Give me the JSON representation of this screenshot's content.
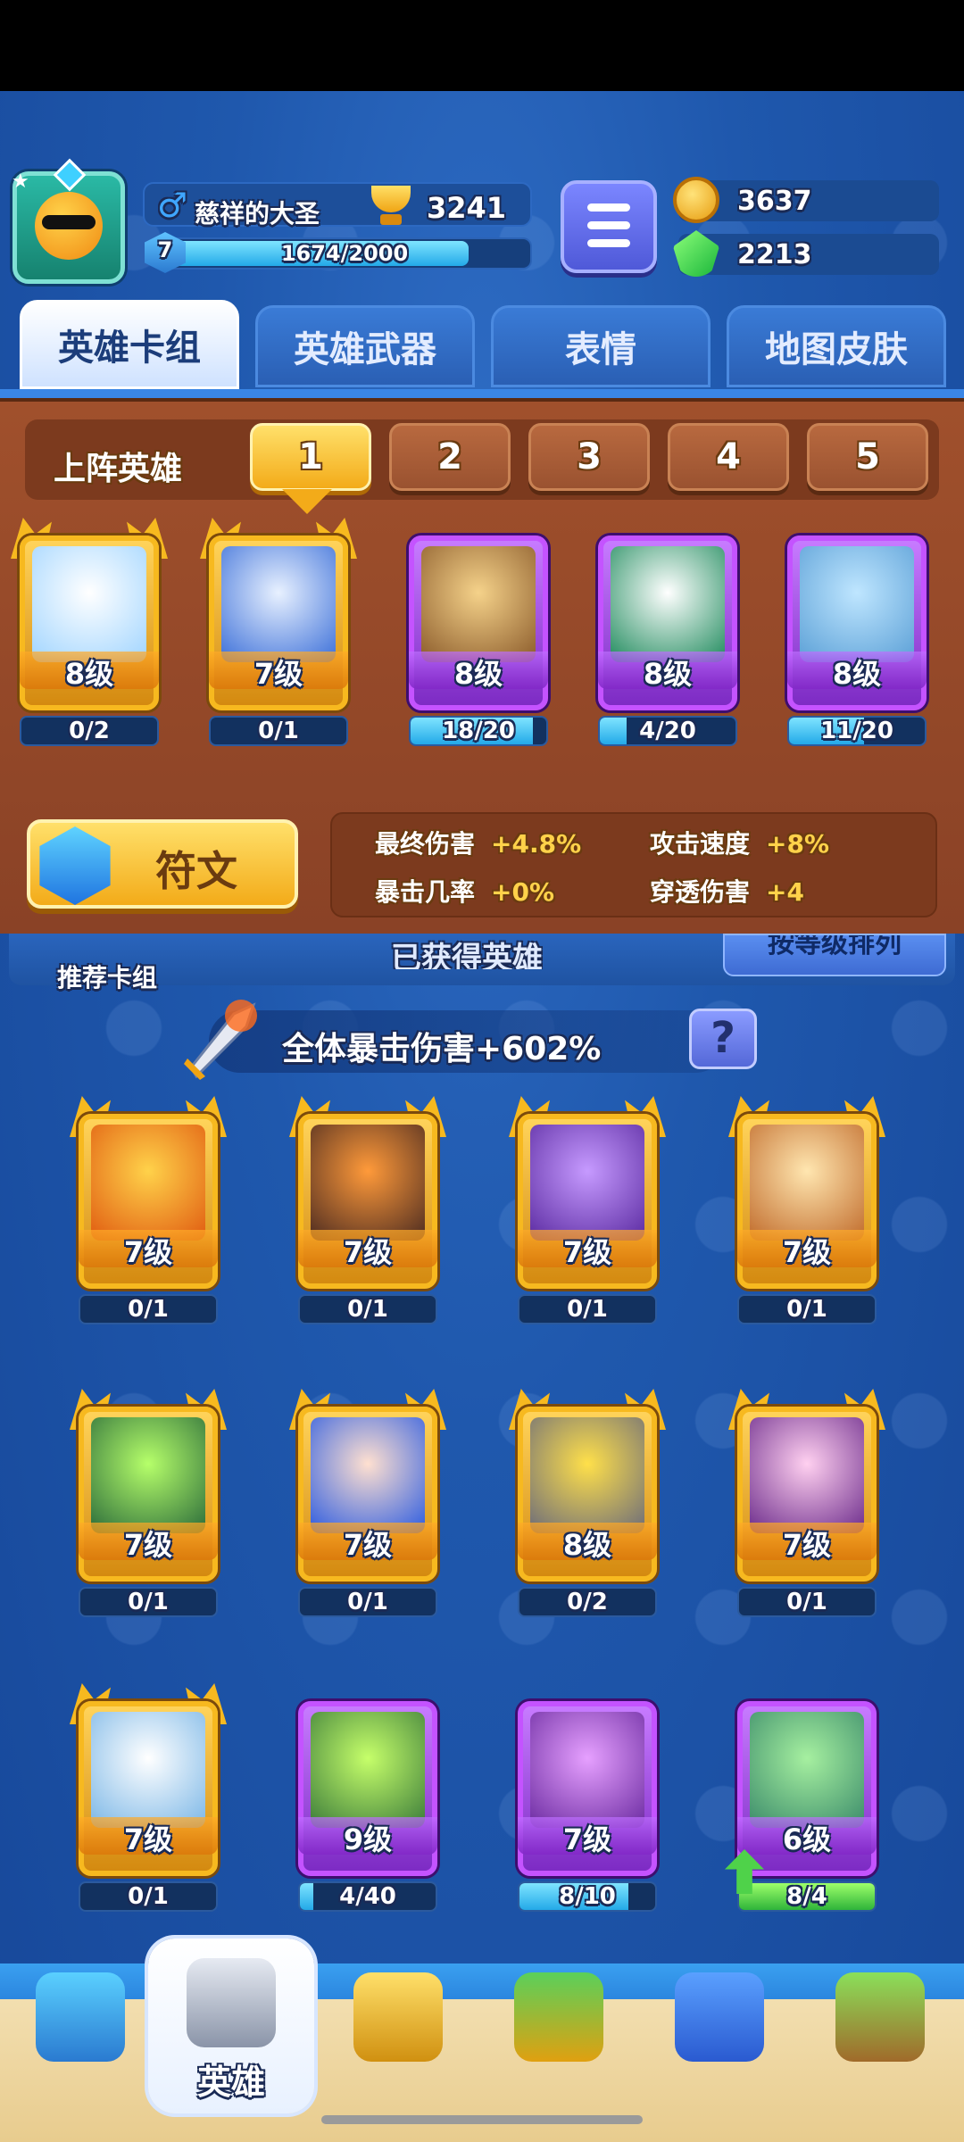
{
  "player": {
    "name": "慈祥的大圣",
    "trophies": "3241",
    "level": "7",
    "xp_text": "1674/2000",
    "xp_progress": 0.837
  },
  "currency": {
    "gold": "3637",
    "gems": "2213"
  },
  "tabs": [
    "英雄卡组",
    "英雄武器",
    "表情",
    "地图皮肤"
  ],
  "lineup": {
    "label": "上阵英雄",
    "slots": [
      "1",
      "2",
      "3",
      "4",
      "5"
    ],
    "active_slot": 1
  },
  "deck_cards": [
    {
      "level": "8级",
      "count": "0/2",
      "progress": 0,
      "rarity": "gold",
      "icon": "yeti-hero-icon"
    },
    {
      "level": "7级",
      "count": "0/1",
      "progress": 0,
      "rarity": "gold",
      "icon": "armored-sage-hero-icon"
    },
    {
      "level": "8级",
      "count": "18/20",
      "progress": 0.9,
      "rarity": "purple",
      "icon": "hooded-mage-hero-icon"
    },
    {
      "level": "8级",
      "count": "4/20",
      "progress": 0.2,
      "rarity": "purple",
      "icon": "masked-ranger-hero-icon"
    },
    {
      "level": "8级",
      "count": "11/20",
      "progress": 0.55,
      "rarity": "purple",
      "icon": "blue-brawler-hero-icon"
    }
  ],
  "rune": {
    "label": "符文"
  },
  "stats": [
    {
      "name": "最终伤害",
      "value": "+4.8%"
    },
    {
      "name": "攻击速度",
      "value": "+8%"
    },
    {
      "name": "暴击几率",
      "value": "+0%"
    },
    {
      "name": "穿透伤害",
      "value": "+4"
    }
  ],
  "section": {
    "recommended": "推荐卡组",
    "obtained": "已获得英雄",
    "sort": "按等级排列"
  },
  "crit_bonus": "全体暴击伤害+602%",
  "owned_cards": [
    {
      "level": "7级",
      "count": "0/1",
      "progress": 0,
      "rarity": "gold",
      "icon": "orange-bomber-hero-icon"
    },
    {
      "level": "7级",
      "count": "0/1",
      "progress": 0,
      "rarity": "gold",
      "icon": "lava-golem-hero-icon"
    },
    {
      "level": "7级",
      "count": "0/1",
      "progress": 0,
      "rarity": "gold",
      "icon": "octopus-pirate-hero-icon"
    },
    {
      "level": "7级",
      "count": "0/1",
      "progress": 0,
      "rarity": "gold",
      "icon": "monkey-king-hero-icon"
    },
    {
      "level": "7级",
      "count": "0/1",
      "progress": 0,
      "rarity": "gold",
      "icon": "green-goblin-hero-icon"
    },
    {
      "level": "7级",
      "count": "0/1",
      "progress": 0,
      "rarity": "gold",
      "icon": "blue-hair-girl-hero-icon"
    },
    {
      "level": "8级",
      "count": "0/2",
      "progress": 0,
      "rarity": "gold",
      "icon": "knight-minion-hero-icon"
    },
    {
      "level": "7级",
      "count": "0/1",
      "progress": 0,
      "rarity": "gold",
      "icon": "skull-reaper-hero-icon"
    },
    {
      "level": "7级",
      "count": "0/1",
      "progress": 0,
      "rarity": "gold",
      "icon": "zeus-hero-icon"
    },
    {
      "level": "9级",
      "count": "4/40",
      "progress": 0.1,
      "rarity": "purple",
      "icon": "frog-archer-hero-icon"
    },
    {
      "level": "7级",
      "count": "8/10",
      "progress": 0.8,
      "rarity": "purple",
      "icon": "magician-hero-icon"
    },
    {
      "level": "6级",
      "count": "8/4",
      "progress": 1,
      "rarity": "purple",
      "icon": "robot-turtle-hero-icon",
      "upgradable": true
    }
  ],
  "nav": [
    {
      "icon": "treasure-chest-icon",
      "label": ""
    },
    {
      "icon": "knight-helmet-icon",
      "label": "英雄"
    },
    {
      "icon": "crossed-swords-icon",
      "label": ""
    },
    {
      "icon": "crown-shield-icon",
      "label": ""
    },
    {
      "icon": "friends-icon",
      "label": ""
    },
    {
      "icon": "sprout-island-icon",
      "label": ""
    }
  ],
  "colors": {
    "gold_frame": "#f7b91f",
    "purple_frame": "#c453ff",
    "panel_brown": "#9a4a28",
    "bg_blue": "#1f58ad"
  }
}
